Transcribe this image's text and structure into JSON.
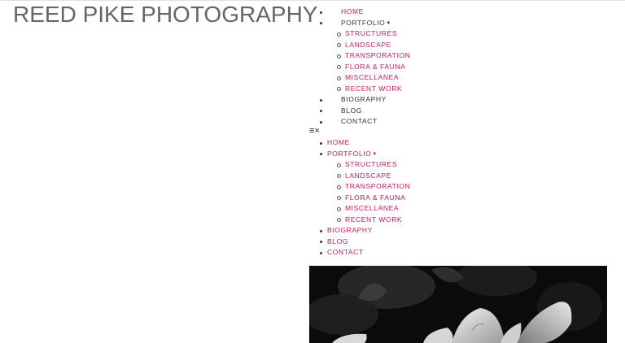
{
  "site": {
    "title": "REED PIKE PHOTOGRAPHY"
  },
  "nav_desktop": {
    "home": "HOME",
    "portfolio": "PORTFOLIO",
    "portfolio_items": [
      "STRUCTURES",
      "LANDSCAPE",
      "TRANSPORATION",
      "FLORA & FAUNA",
      "MISCELLANEA",
      "RECENT WORK"
    ],
    "biography": "BIOGRAPHY",
    "blog": "BLOG",
    "contact": "CONTACT"
  },
  "toggle": {
    "menu_icon": "≡",
    "close_icon": "×"
  },
  "nav_mobile": {
    "home": "HOME",
    "portfolio": "PORTFOLIO",
    "portfolio_items": [
      "STRUCTURES",
      "LANDSCAPE",
      "TRANSPORATION",
      "FLORA & FAUNA",
      "MISCELLANEA",
      "RECENT WORK"
    ],
    "biography": "BIOGRAPHY",
    "blog": "BLOG",
    "contact": "CONTACT"
  },
  "colors": {
    "accent": "#c2185b",
    "text": "#333333",
    "title": "#666666"
  },
  "icons": {
    "caret": "caret-down-icon",
    "menu": "hamburger-menu-icon",
    "close": "close-icon"
  }
}
